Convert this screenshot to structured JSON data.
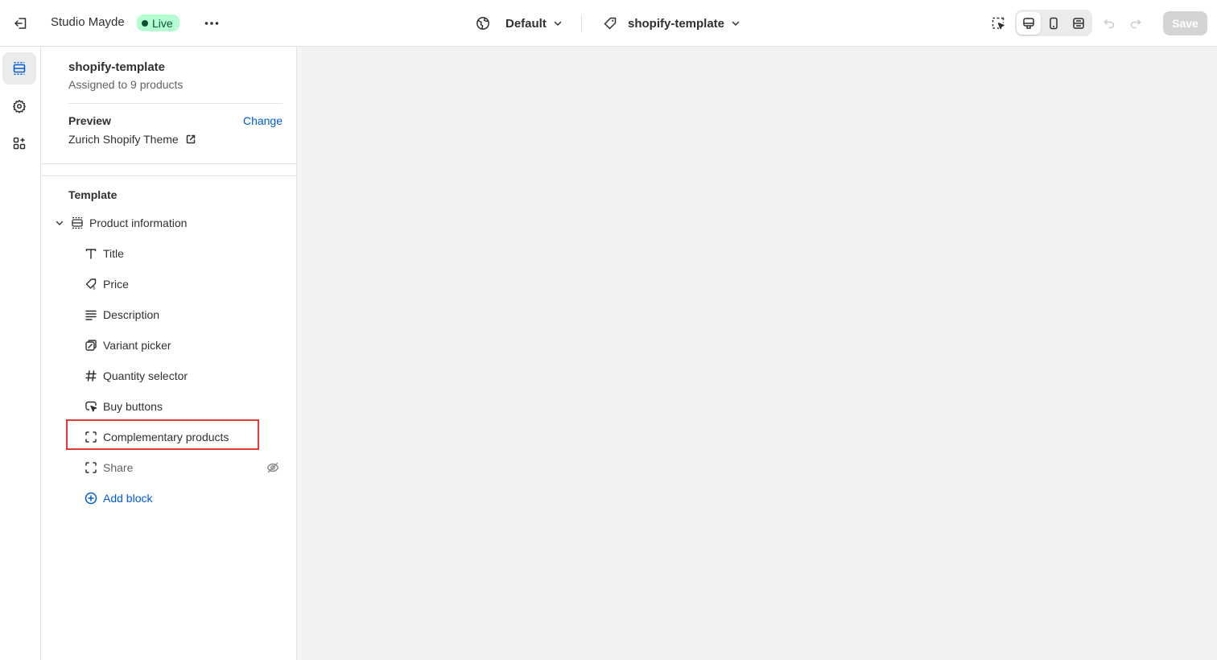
{
  "topbar": {
    "store_name": "Studio Mayde",
    "status_badge": "Live",
    "language_label": "Default",
    "template_label": "shopify-template",
    "save_label": "Save"
  },
  "panel": {
    "template_name": "shopify-template",
    "assigned_text": "Assigned to 9 products",
    "preview_label": "Preview",
    "change_label": "Change",
    "theme_name": "Zurich Shopify Theme",
    "section_label": "Template",
    "section_name": "Product information",
    "blocks": [
      {
        "label": "Title",
        "icon": "text-icon"
      },
      {
        "label": "Price",
        "icon": "price-tag-icon"
      },
      {
        "label": "Description",
        "icon": "text-align-icon"
      },
      {
        "label": "Variant picker",
        "icon": "variant-icon"
      },
      {
        "label": "Quantity selector",
        "icon": "hashtag-icon"
      },
      {
        "label": "Buy buttons",
        "icon": "buy-button-icon"
      },
      {
        "label": "Complementary products",
        "icon": "dashed-frame-icon"
      },
      {
        "label": "Share",
        "icon": "dashed-frame-icon",
        "hidden": true
      }
    ],
    "add_block_label": "Add block"
  },
  "colors": {
    "accent": "#005bd3",
    "live_badge_bg": "#b4fed2",
    "highlight": "#e53935"
  }
}
